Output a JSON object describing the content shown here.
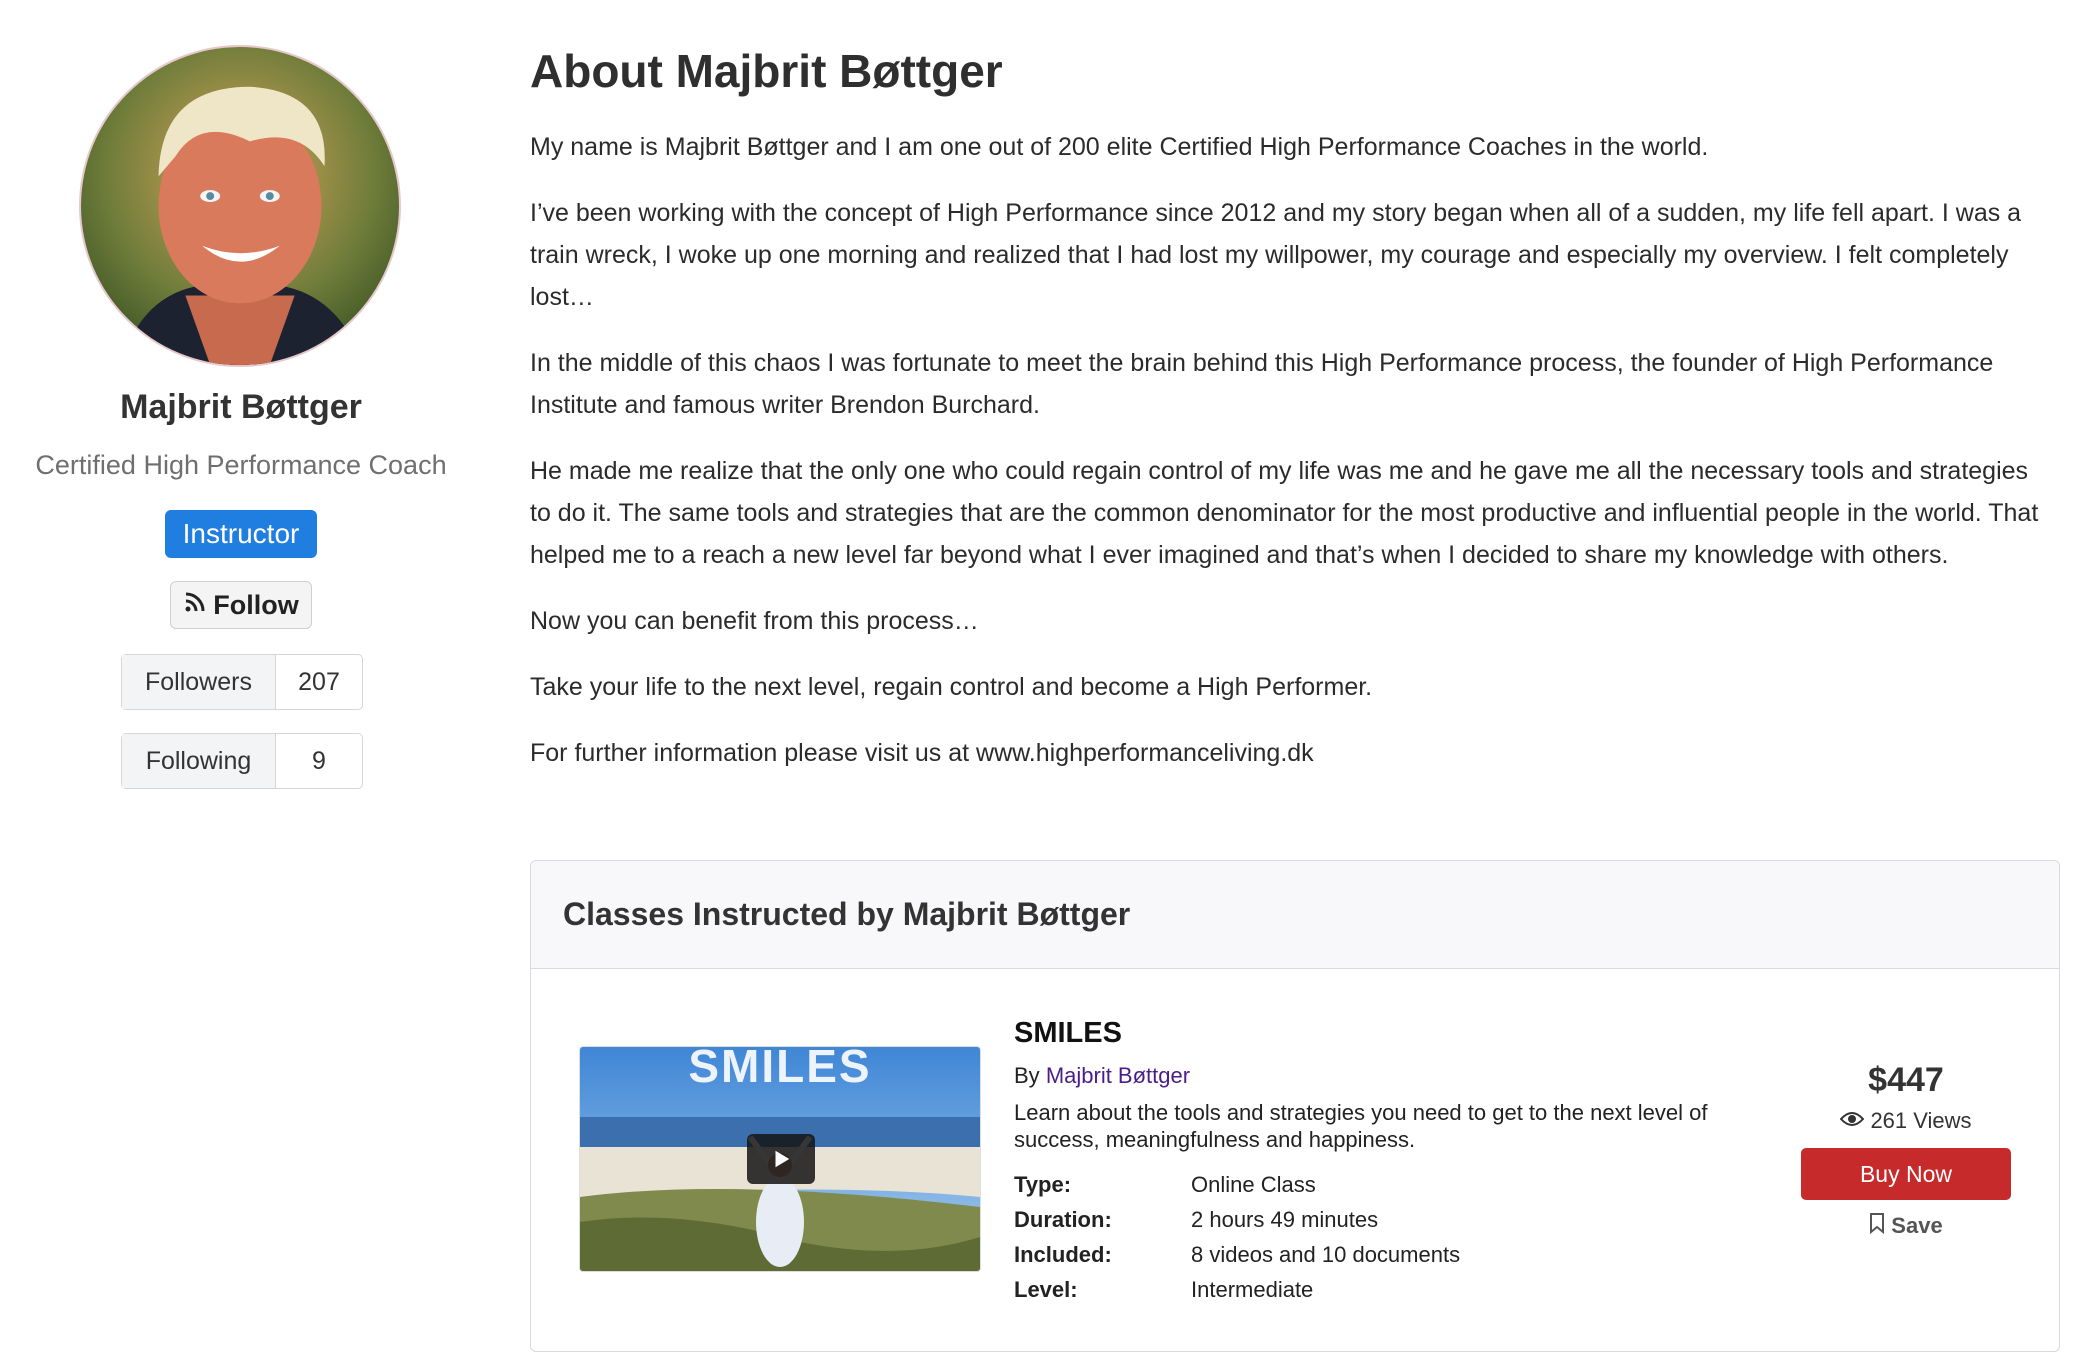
{
  "instructor": {
    "name": "Majbrit Bøttger",
    "title": "Certified High Performance Coach",
    "badge": "Instructor",
    "follow_label": "Follow",
    "followers_label": "Followers",
    "followers_count": "207",
    "following_label": "Following",
    "following_count": "9"
  },
  "about": {
    "title": "About Majbrit Bøttger",
    "paragraphs": [
      "My name is Majbrit Bøttger and I am one out of 200 elite Certified High Performance Coaches in the world.",
      "I’ve been working with the concept of High Performance since 2012 and my story began when all of a sudden, my life fell apart. I was a train wreck, I woke up one morning and realized that I had lost my willpower, my courage and especially my overview. I felt completely lost…",
      "In the middle of this chaos I was fortunate to meet the brain behind this High Performance process, the founder of High Performance Institute and famous writer Brendon Burchard.",
      "He made me realize that the only one who could regain control of my life was me and he gave me all the necessary tools and strategies to do it. The same tools and strategies that are the common denominator for the most productive and influential people in the world. That helped me to a reach a new level far beyond what I ever imagined and that’s when I decided to share my knowledge with others.",
      "Now you can benefit from this process…",
      "Take your life to the next level, regain control and become a High Performer.",
      "For further information please visit us at www.highperformanceliving.dk"
    ]
  },
  "classes": {
    "header": "Classes Instructed by Majbrit Bøttger",
    "items": [
      {
        "thumb_text": "SMILES",
        "title": "SMILES",
        "by_prefix": "By",
        "by_name": "Majbrit Bøttger",
        "description": "Learn about the tools and strategies you need to get to the next level of success, meaningfulness and happiness.",
        "details": [
          {
            "key": "Type:",
            "value": "Online Class"
          },
          {
            "key": "Duration:",
            "value": "2 hours 49 minutes"
          },
          {
            "key": "Included:",
            "value": "8 videos and 10 documents"
          },
          {
            "key": "Level:",
            "value": "Intermediate"
          }
        ],
        "price": "$447",
        "views": "261 Views",
        "buy_label": "Buy Now",
        "save_label": "Save"
      }
    ]
  },
  "colors": {
    "badge": "#1f7ee0",
    "buy": "#c62a2a",
    "link": "#4b1d8a"
  },
  "icons": [
    "rss-icon",
    "play-icon",
    "eye-icon",
    "bookmark-icon"
  ]
}
